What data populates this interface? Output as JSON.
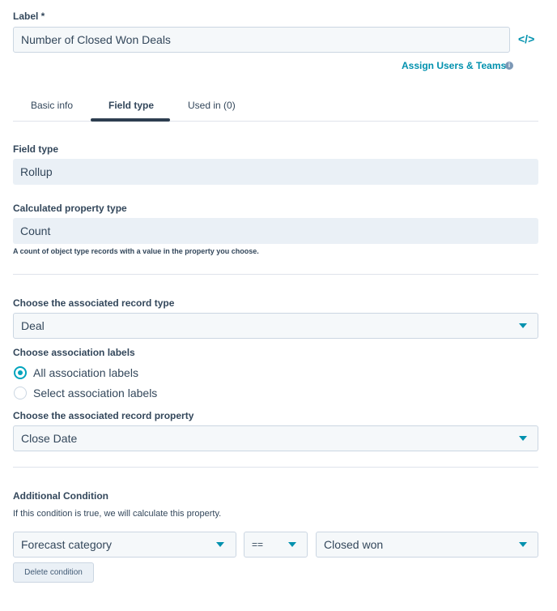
{
  "label_field": {
    "label": "Label *",
    "value": "Number of Closed Won Deals",
    "code_icon_glyph": "</>"
  },
  "assign_link": {
    "label": "Assign Users & Teams",
    "info_icon_glyph": "i"
  },
  "tabs": [
    {
      "label": "Basic info",
      "active": false
    },
    {
      "label": "Field type",
      "active": true
    },
    {
      "label": "Used in (0)",
      "active": false
    }
  ],
  "field_type": {
    "label": "Field type",
    "value": "Rollup"
  },
  "calculated_property_type": {
    "label": "Calculated property type",
    "value": "Count",
    "help": "A count of object type records with a value in the property you choose."
  },
  "associated_record_type": {
    "label": "Choose the associated record type",
    "value": "Deal"
  },
  "association_labels": {
    "label": "Choose association labels",
    "options": [
      {
        "label": "All association labels",
        "checked": true
      },
      {
        "label": "Select association labels",
        "checked": false
      }
    ]
  },
  "associated_record_property": {
    "label": "Choose the associated record property",
    "value": "Close Date"
  },
  "additional_condition": {
    "title": "Additional Condition",
    "description": "If this condition is true, we will calculate this property.",
    "property": "Forecast category",
    "operator": "==",
    "value": "Closed won",
    "delete_label": "Delete condition"
  },
  "colors": {
    "accent": "#0091ae",
    "radio_accent": "#00a4bd",
    "text": "#33475b",
    "input_bg": "#f5f8fa",
    "readonly_bg": "#eaf0f6",
    "border": "#cbd6e2"
  }
}
